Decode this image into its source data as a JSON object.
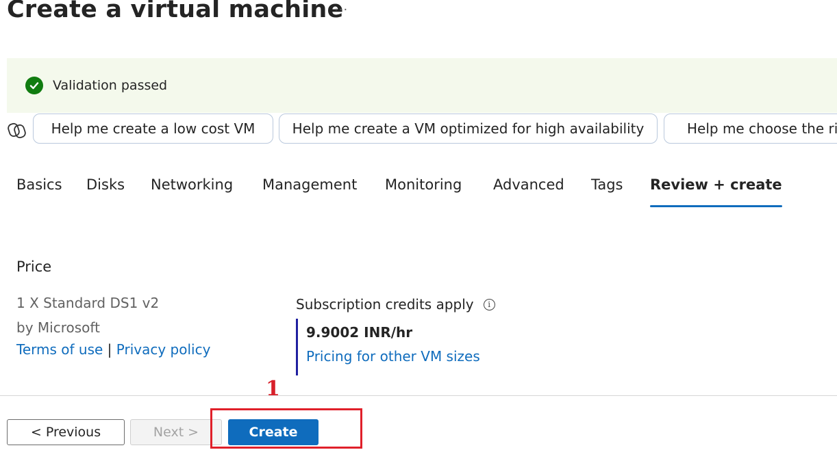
{
  "page": {
    "title": "Create a virtual machine",
    "more_label": "···"
  },
  "banner": {
    "icon": "checkmark-circle-icon",
    "message": "Validation passed",
    "color": "#107c10"
  },
  "copilot": {
    "icon": "copilot-icon"
  },
  "suggestions": [
    "Help me create a low cost VM",
    "Help me create a VM optimized for high availability",
    "Help me choose the rig"
  ],
  "tabs": [
    {
      "label": "Basics",
      "active": false
    },
    {
      "label": "Disks",
      "active": false
    },
    {
      "label": "Networking",
      "active": false
    },
    {
      "label": "Management",
      "active": false
    },
    {
      "label": "Monitoring",
      "active": false
    },
    {
      "label": "Advanced",
      "active": false
    },
    {
      "label": "Tags",
      "active": false
    },
    {
      "label": "Review + create",
      "active": true
    }
  ],
  "price": {
    "heading": "Price",
    "product": "1 X Standard DS1 v2",
    "publisher": "by Microsoft",
    "terms_link": "Terms of use",
    "separator": "|",
    "privacy_link": "Privacy policy",
    "credits_label": "Subscription credits apply",
    "info_icon": "info-icon",
    "rate": "9.9002 INR/hr",
    "other_sizes_link": "Pricing for other VM sizes"
  },
  "footer": {
    "previous_label": "< Previous",
    "next_label": "Next >",
    "create_label": "Create"
  },
  "annotation": {
    "number": "1",
    "color": "#e0202a"
  },
  "colors": {
    "accent": "#0f6cbd",
    "success": "#107c10",
    "banner_bg": "#f4f9ec"
  }
}
